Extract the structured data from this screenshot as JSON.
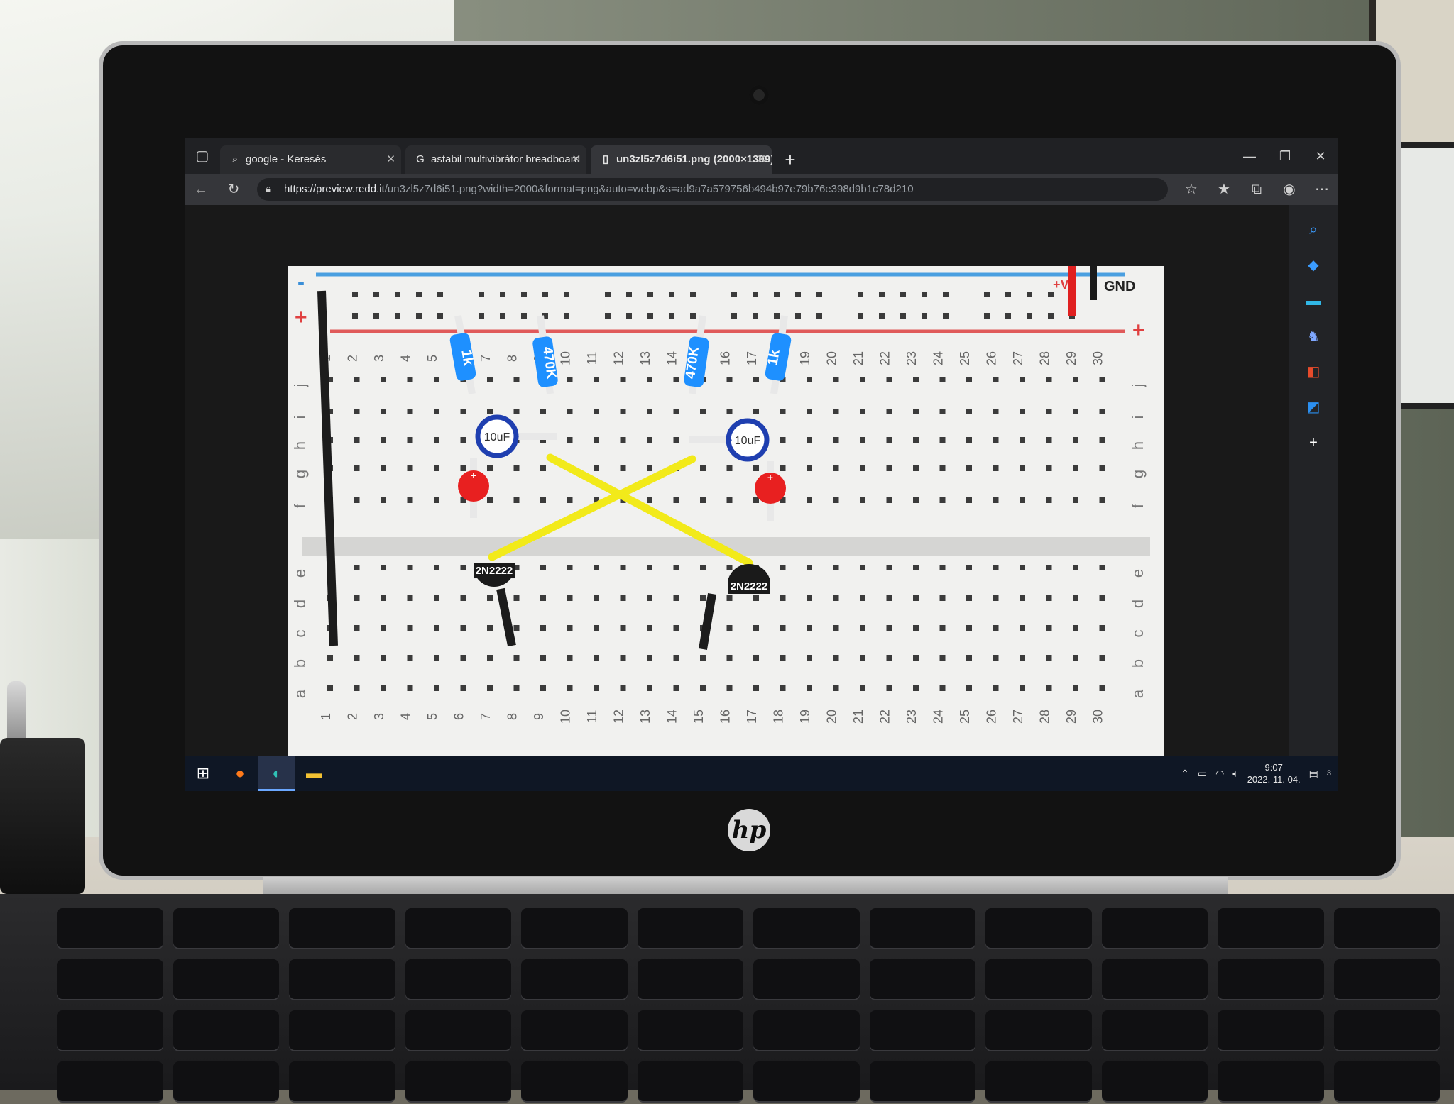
{
  "browser": {
    "tabs": [
      {
        "label": "google - Keresés",
        "icon": "search-icon"
      },
      {
        "label": "astabil multivibrátor breadboard",
        "icon": "google-icon"
      },
      {
        "label": "un3zl5z7d6i51.png (2000×1309)",
        "icon": "page-icon"
      }
    ],
    "new_tab": "+",
    "url_host": "https://preview.redd.it",
    "url_path": "/un3zl5z7d6i51.png?width=2000&format=png&auto=webp&s=ad9a7a579756b494b97e79b76e398d9b1c78d210"
  },
  "image": {
    "top_row_numbers": [
      "1",
      "2",
      "3",
      "4",
      "5",
      "6",
      "7",
      "8",
      "9",
      "10",
      "11",
      "12",
      "13",
      "14",
      "15",
      "16",
      "17",
      "18",
      "19",
      "20",
      "21",
      "22",
      "23",
      "24",
      "25",
      "26",
      "27",
      "28",
      "29",
      "30"
    ],
    "row_letters_top": [
      "j",
      "i",
      "h",
      "g",
      "f"
    ],
    "row_letters_bottom": [
      "e",
      "d",
      "c",
      "b",
      "a"
    ],
    "rail_plus": "+",
    "rail_minus": "-",
    "label_vplus": "+V",
    "label_gnd": "GND",
    "resistors": [
      "1k",
      "470K",
      "470K",
      "1k"
    ],
    "capacitors": [
      "10uF",
      "10uF"
    ],
    "cap_plus": "+",
    "led_plus": "+",
    "transistors": [
      "2N2222",
      "2N2222"
    ]
  },
  "taskbar": {
    "time": "9:07",
    "date": "2022. 11. 04.",
    "notifications": "3"
  },
  "hardware": {
    "logo": "hp"
  }
}
